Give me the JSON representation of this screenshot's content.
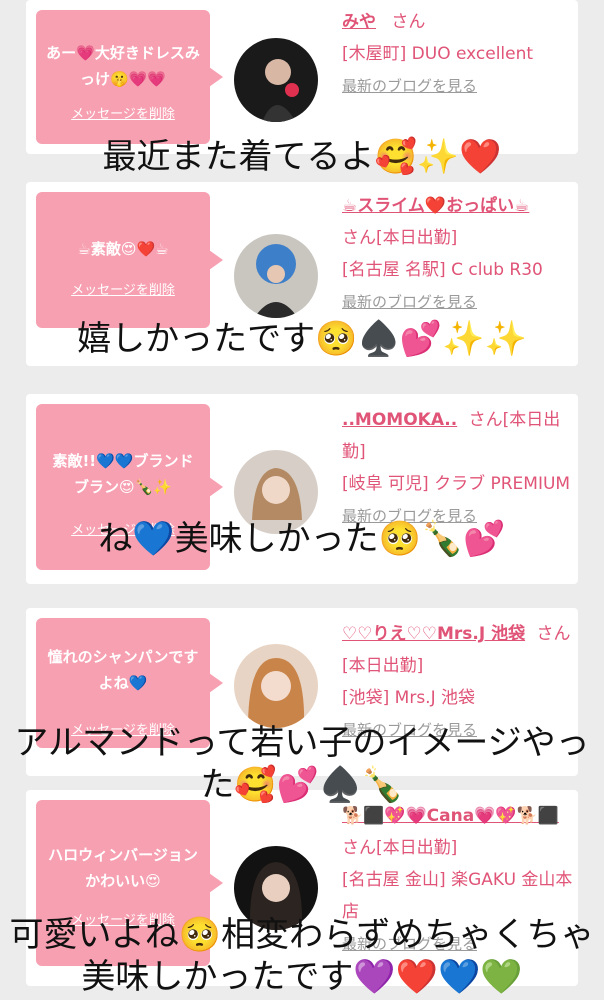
{
  "cards": [
    {
      "message": "あー💗大好きドレスみっけ🤫💗💗",
      "delete_label": "メッセージを削除",
      "name": "みや",
      "san": "さん",
      "shop": "[木屋町] DUO excellent",
      "blog": "最新のブログを見る"
    },
    {
      "message": "☕素敵😍❤️☕",
      "delete_label": "メッセージを削除",
      "name": "☕スライム❤️おっぱい☕",
      "san": "さん[本日出勤]",
      "shop": "[名古屋 名駅] C club R30",
      "blog": "最新のブログを見る"
    },
    {
      "message": "素敵!!💙💙ブランドブラン😍🍾✨",
      "delete_label": "メッセージを削除",
      "name": "..MOMOKA..",
      "san": "さん[本日出勤]",
      "shop": "[岐阜 可児] クラブ PREMIUM",
      "blog": "最新のブログを見る"
    },
    {
      "message": "憧れのシャンパンですよね💙",
      "delete_label": "メッセージを削除",
      "name": "♡♡りえ♡♡Mrs.J 池袋",
      "san": "さん[本日出勤]",
      "shop": "[池袋] Mrs.J 池袋",
      "blog": "最新のブログを見る"
    },
    {
      "message": "ハロウィンバージョンかわいい😍",
      "delete_label": "メッセージを削除",
      "name": "🐕⬛💖💗Cana💗💖🐕⬛",
      "san": "さん[本日出勤]",
      "shop": "[名古屋 金山] 楽GAKU 金山本店",
      "blog": "最新のブログを見る"
    }
  ],
  "captions": [
    {
      "line1": "最近また着てるよ🥰✨❤️"
    },
    {
      "line1": "嬉しかったです🥺♠️💕✨✨"
    },
    {
      "line1": "ね💙美味しかった🥺🍾💕"
    },
    {
      "line1": "アルマンドって若い子のイメージやっ",
      "line2": "た🥰💕♠️🍾"
    },
    {
      "line1": "可愛いよね🥺相変わらずめちゃくちゃ",
      "line2": "美味しかったです💜❤️💙💚"
    }
  ]
}
